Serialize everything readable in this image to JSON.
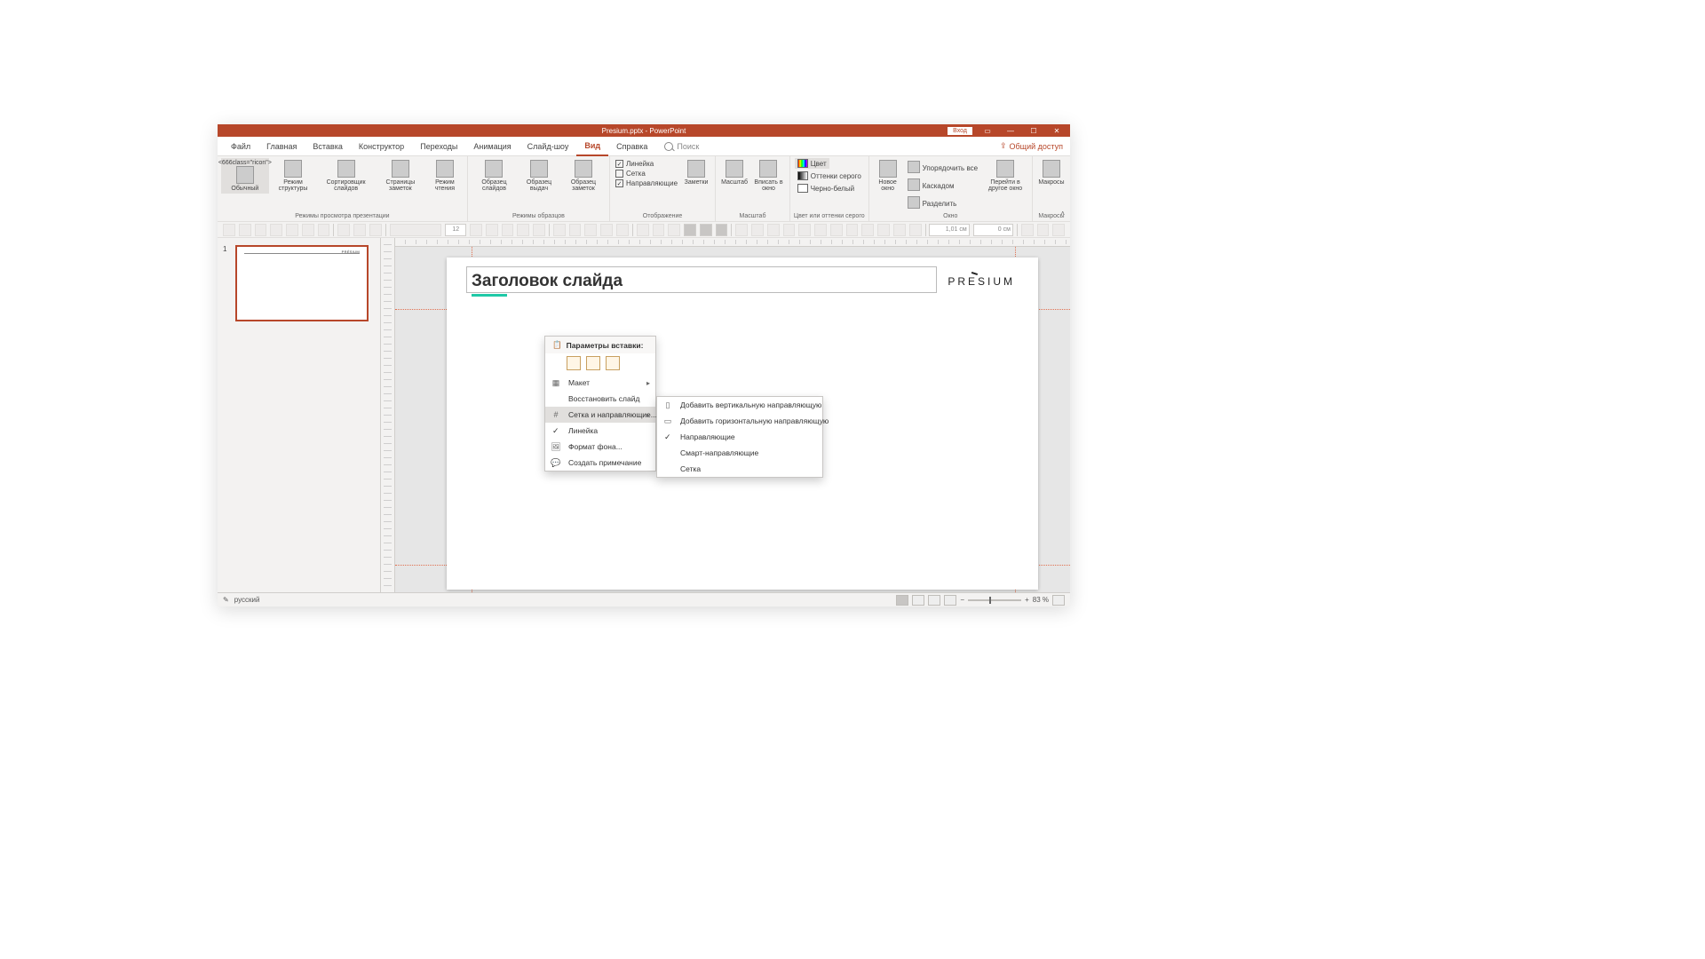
{
  "title": "Presium.pptx - PowerPoint",
  "signin": "Вход",
  "menus": [
    "Файл",
    "Главная",
    "Вставка",
    "Конструктор",
    "Переходы",
    "Анимация",
    "Слайд-шоу",
    "Вид",
    "Справка"
  ],
  "active_menu": 7,
  "search_placeholder": "Поиск",
  "share": "Общий доступ",
  "ribbon": {
    "group_views": {
      "label": "Режимы просмотра презентации",
      "buttons": [
        {
          "t": "Обычный"
        },
        {
          "t": "Режим структуры"
        },
        {
          "t": "Сортировщик слайдов"
        },
        {
          "t": "Страницы заметок"
        },
        {
          "t": "Режим чтения"
        }
      ]
    },
    "group_masters": {
      "label": "Режимы образцов",
      "buttons": [
        {
          "t": "Образец слайдов"
        },
        {
          "t": "Образец выдач"
        },
        {
          "t": "Образец заметок"
        }
      ]
    },
    "group_show": {
      "label": "Отображение",
      "ruler": "Линейка",
      "grid": "Сетка",
      "guides": "Направляющие",
      "notes": "Заметки"
    },
    "group_zoom": {
      "label": "Масштаб",
      "zoom": "Масштаб",
      "fit": "Вписать в окно"
    },
    "group_color": {
      "label": "Цвет или оттенки серого",
      "color": "Цвет",
      "gray": "Оттенки серого",
      "bw": "Черно-белый"
    },
    "group_window": {
      "label": "Окно",
      "neww": "Новое окно",
      "arrange": "Упорядочить все",
      "cascade": "Каскадом",
      "split": "Разделить",
      "switch": "Перейти в другое окно"
    },
    "group_macro": {
      "label": "Макросы",
      "btn": "Макросы"
    }
  },
  "toolbar2": {
    "font_size": "12",
    "field1": "1,01 см",
    "field2": "0 см"
  },
  "thumb_number": "1",
  "thumb_logo": "PRÉSIUM",
  "slide": {
    "title": "Заголовок слайда",
    "brand": "PRESIUM"
  },
  "ctx1": {
    "paste_header": "Параметры вставки:",
    "layout": "Макет",
    "reset": "Восстановить слайд",
    "grid_guides": "Сетка и направляющие...",
    "ruler": "Линейка",
    "format_bg": "Формат фона...",
    "comment": "Создать примечание"
  },
  "ctx2": {
    "add_v": "Добавить вертикальную направляющую",
    "add_h": "Добавить горизонтальную направляющую",
    "guides": "Направляющие",
    "smart": "Смарт-направляющие",
    "grid": "Сетка"
  },
  "status": {
    "lang": "русский",
    "zoom": "83 %"
  }
}
